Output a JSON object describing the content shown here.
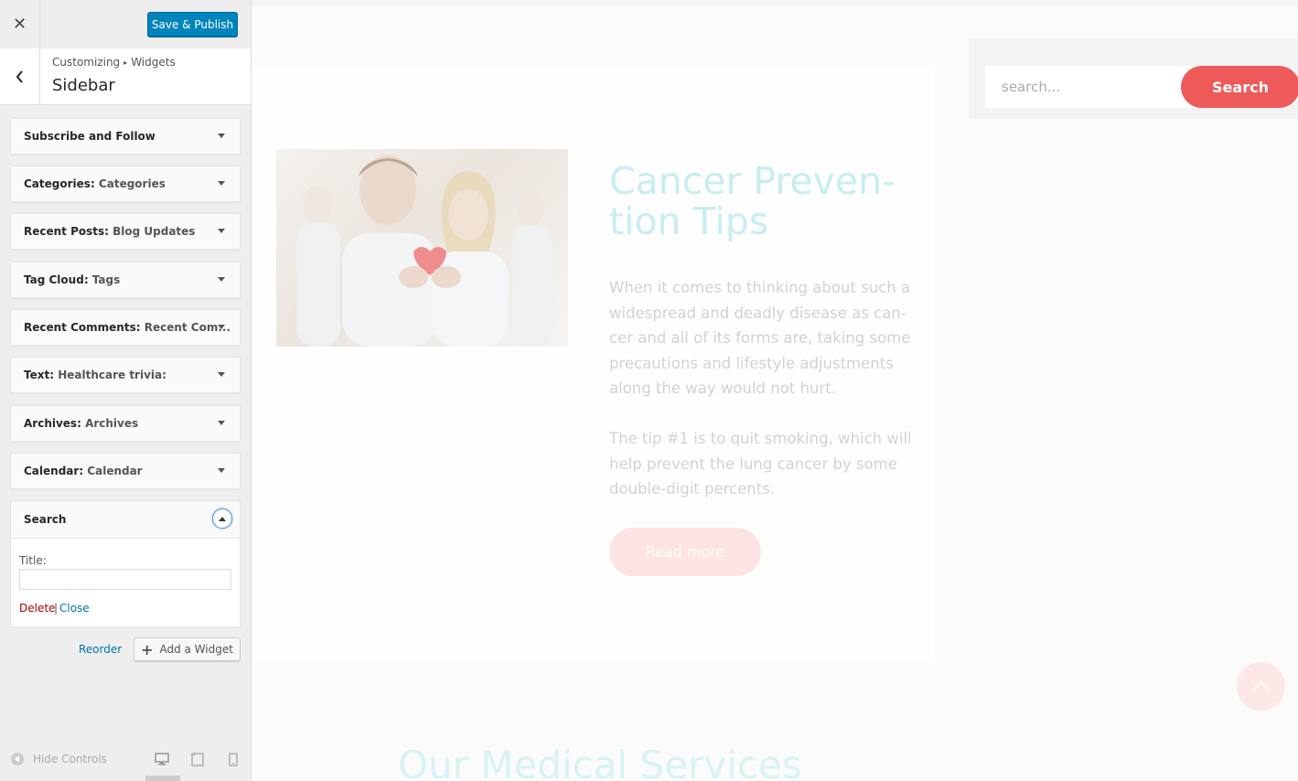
{
  "customizer": {
    "close_icon": "close-x-icon",
    "save_label": "Save & Publish",
    "breadcrumb": [
      "Customizing",
      "Widgets"
    ],
    "breadcrumb_sep": "▸",
    "section_title": "Sidebar",
    "widgets": [
      {
        "title": "Subscribe and Follow",
        "subtitle": ""
      },
      {
        "title": "Categories",
        "subtitle": "Categories"
      },
      {
        "title": "Recent Posts",
        "subtitle": "Blog Updates"
      },
      {
        "title": "Tag Cloud",
        "subtitle": "Tags"
      },
      {
        "title": "Recent Comments",
        "subtitle": "Recent Com..."
      },
      {
        "title": "Text",
        "subtitle": "Healthcare trivia:"
      },
      {
        "title": "Archives",
        "subtitle": "Archives"
      },
      {
        "title": "Calendar",
        "subtitle": "Calendar"
      }
    ],
    "open_widget": {
      "title": "Search",
      "field_label": "Title:",
      "field_value": "",
      "delete_label": "Delete",
      "separator": "|",
      "close_label": "Close"
    },
    "reorder_label": "Reorder",
    "add_widget_label": "Add a Widget",
    "hide_controls_label": "Hide Controls",
    "devices": [
      "desktop-icon",
      "tablet-icon",
      "mobile-icon"
    ]
  },
  "preview": {
    "post_title": "Cancer Preven-\ntion Tips",
    "paragraph_1": "When it comes to thinking about such a widespread and deadly disease as can-cer and all of its forms are, taking some precautions and lifestyle adjustments along the way would not hurt.",
    "paragraph_2": "The tip #1 is to quit smoking, which will help prevent the lung cancer by some double-digit percents.",
    "read_more_label": "Read more",
    "search_placeholder": "search...",
    "search_button_label": "Search",
    "services_heading": "Our Medical Services"
  },
  "colors": {
    "primary_button": "#0085ba",
    "delete_link": "#aa0000",
    "link": "#0073aa",
    "accent_red": "#ee5a5a",
    "title_teal": "#c7eef1"
  }
}
